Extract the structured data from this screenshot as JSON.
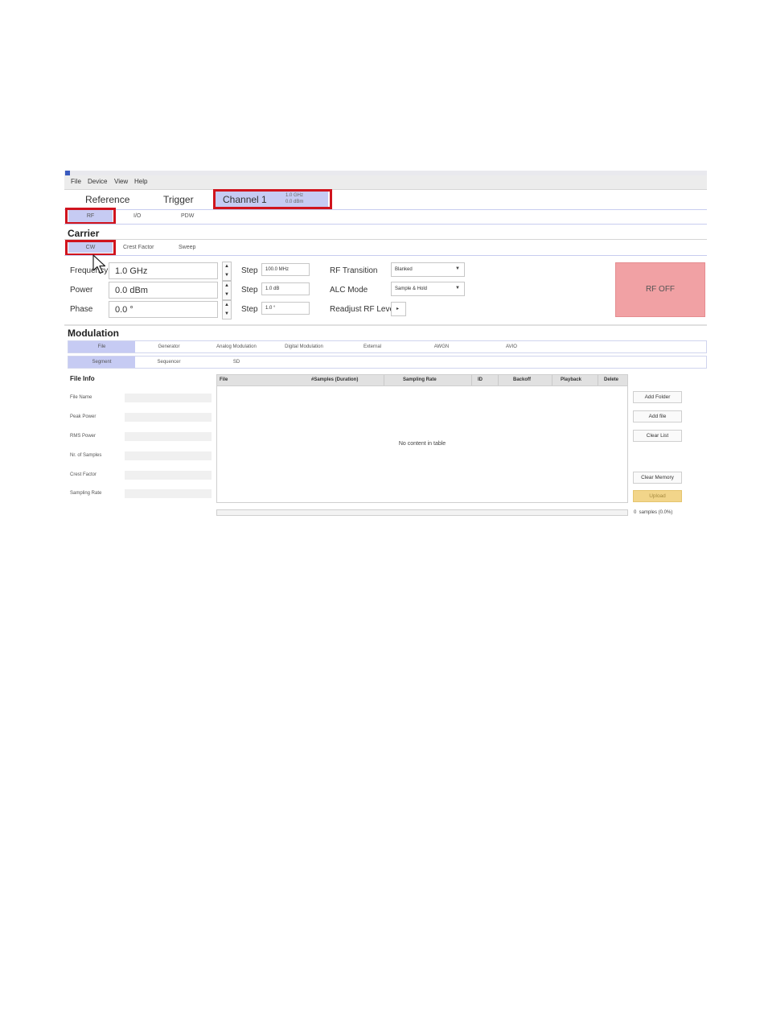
{
  "menu": [
    "File",
    "Device",
    "View",
    "Help"
  ],
  "top_tabs": {
    "reference": "Reference",
    "trigger": "Trigger"
  },
  "channel": {
    "name": "Channel 1",
    "freq": "1.0 GHz",
    "power": "0.0 dBm"
  },
  "sub_tabs": [
    "RF",
    "I/O",
    "PDW"
  ],
  "carrier": {
    "title": "Carrier",
    "tabs": [
      "CW",
      "Crest Factor",
      "Sweep"
    ],
    "frequency": {
      "label": "Frequency",
      "value": "1.0 GHz",
      "step_label": "Step",
      "step": "100.0 MHz"
    },
    "power": {
      "label": "Power",
      "value": "0.0 dBm",
      "step_label": "Step",
      "step": "1.0 dB"
    },
    "phase": {
      "label": "Phase",
      "value": "0.0 °",
      "step_label": "Step",
      "step": "1.0 °"
    },
    "rf_transition": {
      "label": "RF Transition",
      "value": "Blanked"
    },
    "alc_mode": {
      "label": "ALC Mode",
      "value": "Sample & Hold"
    },
    "readjust": {
      "label": "Readjust RF Level",
      "button": "▸"
    },
    "rf_button": "RF OFF"
  },
  "modulation": {
    "title": "Modulation",
    "tabs": [
      "File",
      "Generator",
      "Analog Modulation",
      "Digital Modulation",
      "External",
      "AWGN",
      "AVIO"
    ],
    "sub_tabs": [
      "Segment",
      "Sequencer",
      "SD"
    ]
  },
  "file_info": {
    "title": "File Info",
    "fields": [
      "File Name",
      "Peak Power",
      "RMS Power",
      "Nr. of Samples",
      "Crest Factor",
      "Sampling Rate"
    ]
  },
  "table": {
    "columns": [
      "File",
      "#Samples (Duration)",
      "Sampling Rate",
      "ID",
      "Backoff",
      "Playback",
      "Delete"
    ],
    "empty_text": "No content in table"
  },
  "buttons": {
    "add_folder": "Add Folder",
    "add_file": "Add file",
    "clear_list": "Clear List",
    "clear_memory": "Clear Memory",
    "upload": "Upload"
  },
  "progress": {
    "text": "0  samples (0.0%)",
    "value": 0
  },
  "colors": {
    "selected_tab": "#c6cbf3",
    "highlight": "#d0141e",
    "rf_off": "#f1a1a4",
    "upload": "#f2d58a"
  }
}
